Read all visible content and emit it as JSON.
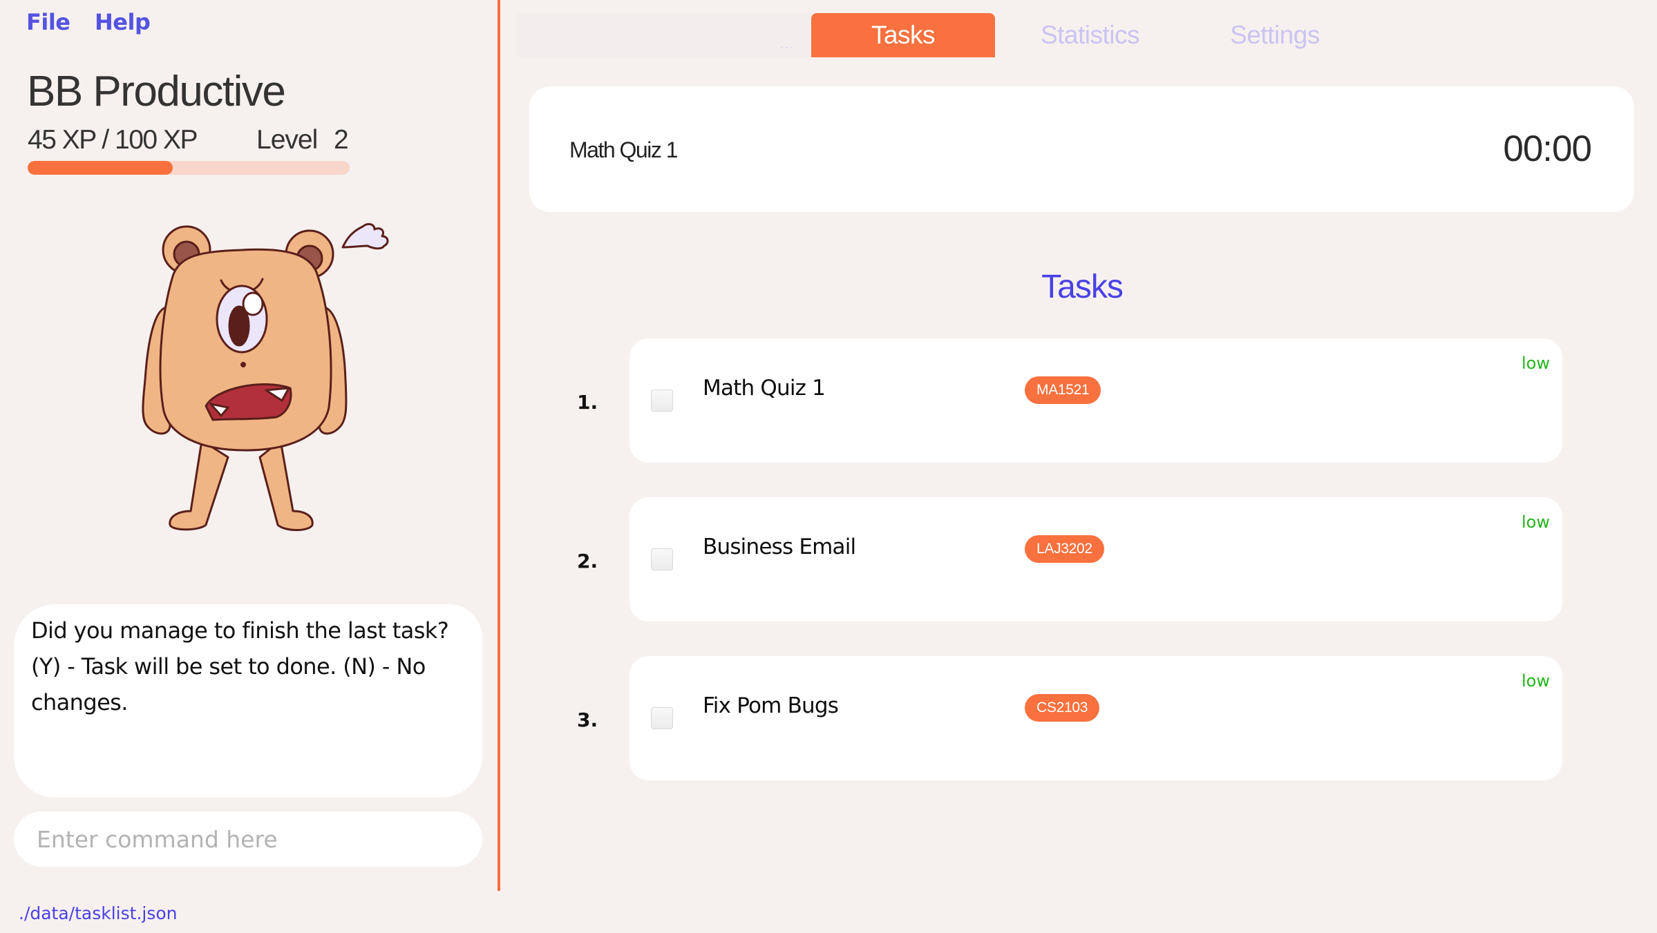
{
  "menu": {
    "file": "File",
    "help": "Help"
  },
  "profile": {
    "app_title": "BB Productive",
    "xp_current": 45,
    "xp_max": 100,
    "xp_text": "45 XP / 100 XP",
    "level_label": "Level",
    "level_value": "2",
    "xp_progress_fraction": 0.45,
    "mascot": "angry-one-eyed-bear-monster"
  },
  "response": {
    "text": "Did you manage to finish the last task? (Y) - Task will be set to done. (N) - No changes."
  },
  "command": {
    "value": "",
    "placeholder": "Enter command here"
  },
  "footer": {
    "storage_path": "./data/tasklist.json"
  },
  "tabs": {
    "overflow": "...",
    "items": [
      {
        "label": "Tasks",
        "active": true
      },
      {
        "label": "Statistics",
        "active": false
      },
      {
        "label": "Settings",
        "active": false
      }
    ]
  },
  "timer": {
    "task_name": "Math Quiz 1",
    "value": "00:00"
  },
  "task_list": {
    "heading": "Tasks",
    "tasks": [
      {
        "index": "1.",
        "name": "Math Quiz 1",
        "tag": "MA1521",
        "priority": "low",
        "done": false
      },
      {
        "index": "2.",
        "name": "Business Email",
        "tag": "LAJ3202",
        "priority": "low",
        "done": false
      },
      {
        "index": "3.",
        "name": "Fix Pom Bugs",
        "tag": "CS2103",
        "priority": "low",
        "done": false
      }
    ]
  },
  "colors": {
    "accent": "#f8713e",
    "accent_light": "#f8d6cc",
    "link": "#4a40e6",
    "priority_low": "#23b51b",
    "tab_inactive": "#c9c4f0",
    "background": "#f6f1ef"
  }
}
